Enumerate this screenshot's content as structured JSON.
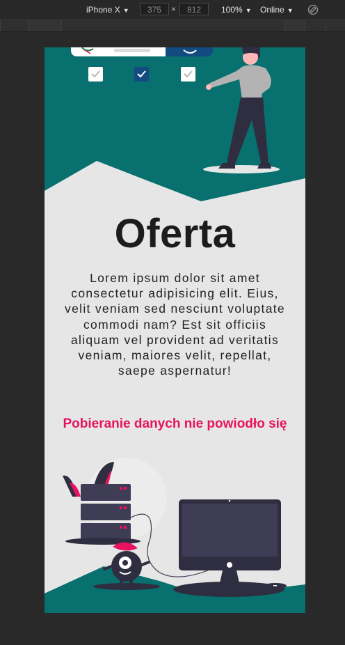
{
  "devtools": {
    "device": "iPhone X",
    "width": "375",
    "height": "812",
    "times": "×",
    "zoom": "100%",
    "network": "Online"
  },
  "content": {
    "title": "Oferta",
    "description": "Lorem ipsum dolor sit amet consectetur adipisicing elit. Eius, velit veniam sed nesciunt voluptate commodi nam? Est sit officiis aliquam vel provident ad veritatis veniam, maiores velit, repellat, saepe aspernatur!",
    "error": "Pobieranie danych nie powiodło się"
  },
  "colors": {
    "teal": "#08706e",
    "pink": "#e8125f",
    "navy": "#134a80",
    "dark": "#2f2e41"
  }
}
